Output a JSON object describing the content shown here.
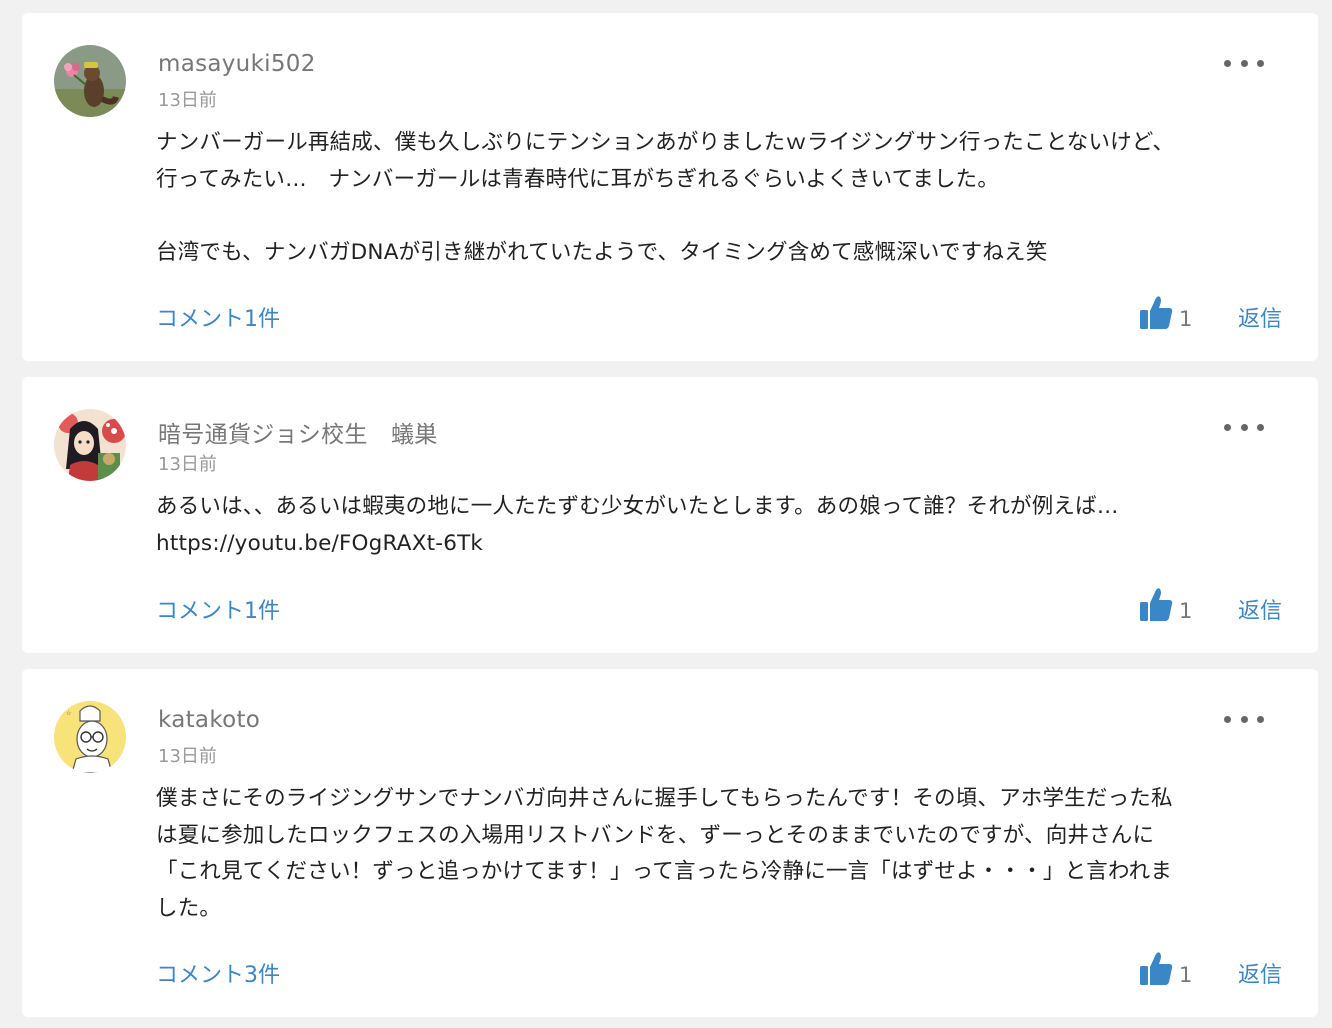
{
  "colors": {
    "link": "#3b86c6",
    "like": "#3b86c6",
    "username": "#777777",
    "timestamp": "#999999",
    "text": "#222222",
    "card_bg": "#ffffff",
    "page_bg": "#f1f1f1"
  },
  "comments": [
    {
      "username": "masayuki502",
      "timestamp": "13日前",
      "avatar_icon": "beaver-avatar-icon",
      "lines": [
        "ナンバーガール再結成、僕も久しぶりにテンションあがりましたｗライジングサン行ったことないけど、",
        "行ってみたい…　ナンバーガールは青春時代に耳がちぎれるぐらいよくきいてました。",
        "",
        "台湾でも、ナンバガDNAが引き継がれていたようで、タイミング含めて感慨深いですねえ笑"
      ],
      "replies_label": "コメント1件",
      "likes": "1",
      "reply_label": "返信",
      "menu_icon": "more-options-icon"
    },
    {
      "username": "暗号通貨ジョシ校生　蟻巣",
      "timestamp": "13日前",
      "avatar_icon": "anime-girl-avatar-icon",
      "lines": [
        "あるいは、、あるいは蝦夷の地に一人たたずむ少女がいたとします。あの娘って誰？それが例えば…",
        "https://youtu.be/FOgRAXt-6Tk"
      ],
      "replies_label": "コメント1件",
      "likes": "1",
      "reply_label": "返信",
      "menu_icon": "more-options-icon"
    },
    {
      "username": "katakoto",
      "timestamp": "13日前",
      "avatar_icon": "sketch-person-avatar-icon",
      "lines": [
        "僕まさにそのライジングサンでナンバガ向井さんに握手してもらったんです！その頃、アホ学生だった私",
        "は夏に参加したロックフェスの入場用リストバンドを、ずーっとそのままでいたのですが、向井さんに",
        "「これ見てください！ずっと追っかけてます！」って言ったら冷静に一言「はずせよ・・・」と言われま",
        "した。"
      ],
      "replies_label": "コメント3件",
      "likes": "1",
      "reply_label": "返信",
      "menu_icon": "more-options-icon"
    }
  ]
}
